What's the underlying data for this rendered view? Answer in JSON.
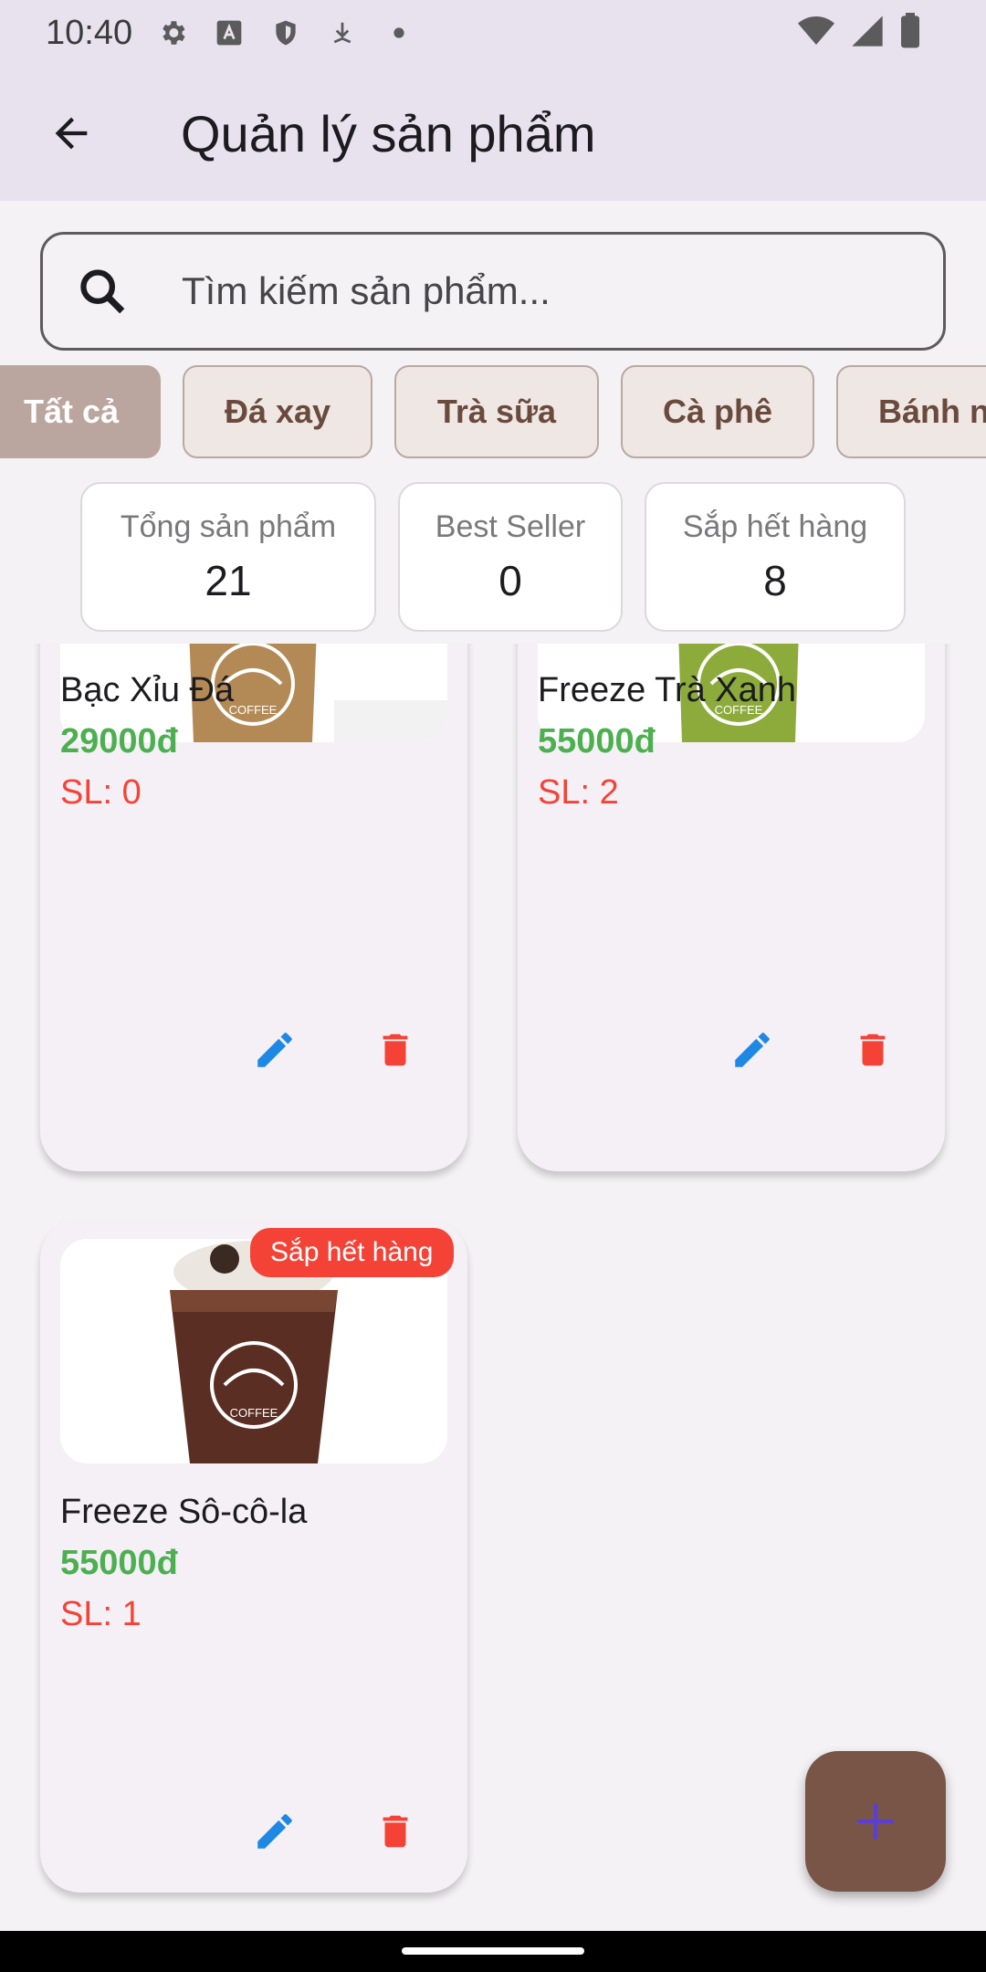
{
  "status_bar": {
    "time": "10:40"
  },
  "app_bar": {
    "title": "Quản lý sản phẩm"
  },
  "search": {
    "placeholder": "Tìm kiếm sản phẩm..."
  },
  "categories": [
    "Tất cả",
    "Đá xay",
    "Trà sữa",
    "Cà phê",
    "Bánh ng"
  ],
  "selected_category": "Tất cả",
  "stats": [
    {
      "label": "Tổng sản phẩm",
      "value": "21"
    },
    {
      "label": "Best Seller",
      "value": "0"
    },
    {
      "label": "Sắp hết hàng",
      "value": "8"
    }
  ],
  "products": [
    {
      "name": "Bạc Xỉu Đá",
      "price": "29000đ",
      "qty": "SL: 0",
      "badge": "",
      "drink_color": "#b38a55"
    },
    {
      "name": "Freeze Trà Xanh",
      "price": "55000đ",
      "qty": "SL: 2",
      "badge": "",
      "drink_color": "#8cab3a"
    },
    {
      "name": "Freeze Sô-cô-la",
      "price": "55000đ",
      "qty": "SL: 1",
      "badge": "Sắp hết hàng",
      "drink_color": "#5a2e22"
    }
  ],
  "logo_text": "COFFEE",
  "colors": {
    "accent": "#795548",
    "price": "#4caf50",
    "low_stock": "#f44336",
    "edit": "#1e88e5",
    "delete": "#f44336"
  }
}
